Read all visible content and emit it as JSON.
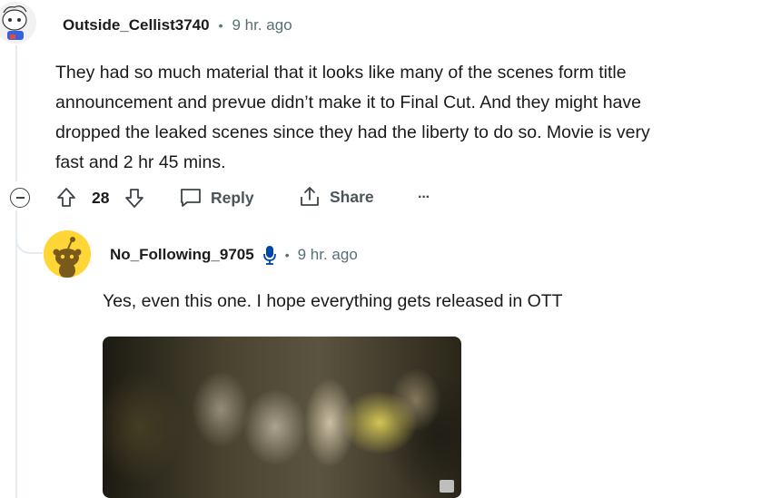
{
  "comment": {
    "author": "Outside_Cellist3740",
    "separator": "•",
    "time": "9 hr. ago",
    "body_lines": [
      "They had so much material that it looks like many of the scenes form title",
      "announcement and prevue didn’t make it to Final Cut. And they might have",
      "dropped the leaked scenes since they had the liberty to do so. Movie is very",
      "fast and 2 hr 45 mins."
    ],
    "actions": {
      "vote_count": "28",
      "reply_label": "Reply",
      "share_label": "Share",
      "more_label": "···"
    }
  },
  "reply": {
    "author": "No_Following_9705",
    "separator": "•",
    "time": "9 hr. ago",
    "body": "Yes, even this one. I hope everything gets released in OTT",
    "badge_color": "#0045ac"
  },
  "colors": {
    "meta_gray": "#576f76",
    "thread_line": "#e5ebee",
    "reply_avatar_bg": "#ffd635"
  }
}
